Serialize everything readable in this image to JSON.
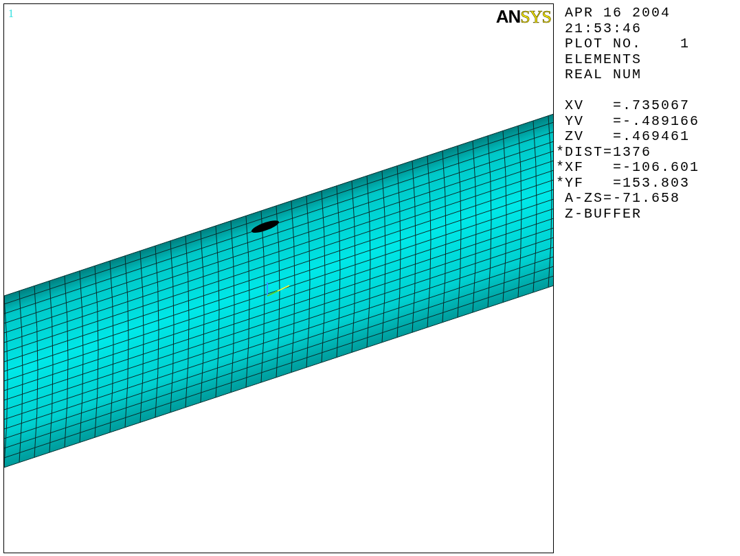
{
  "plot": {
    "window_number": "1",
    "logo": {
      "dark_part": "AN",
      "light_part": "SYS"
    }
  },
  "legend": {
    "header_lines": [
      "APR 16 2004",
      "21:53:46",
      "PLOT NO.    1",
      "ELEMENTS",
      "REAL NUM"
    ],
    "view_lines": [
      {
        "text": "XV   =.735067"
      },
      {
        "text": "YV   =-.489166"
      },
      {
        "text": "ZV   =.469461"
      },
      {
        "mark": "*",
        "text": "DIST=1376"
      },
      {
        "mark": "*",
        "text": "XF   =-106.601"
      },
      {
        "mark": "*",
        "text": "YF   =153.803"
      },
      {
        "text": "A-ZS=-71.658"
      },
      {
        "text": "Z-BUFFER"
      }
    ]
  }
}
